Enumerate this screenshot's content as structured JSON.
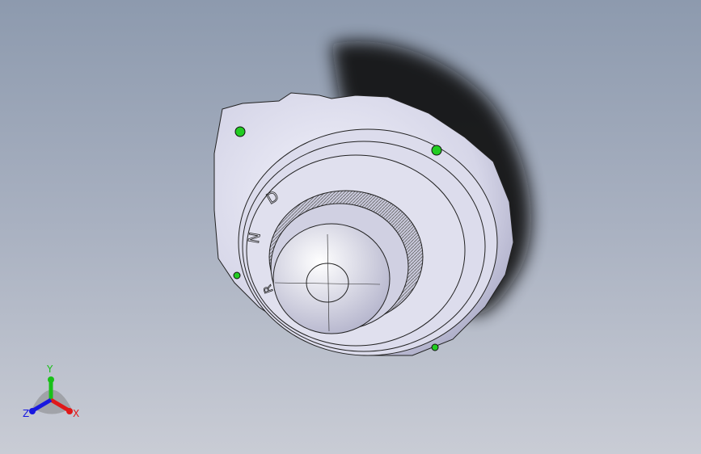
{
  "viewport": {
    "model_markings": [
      "D",
      "N",
      "R"
    ],
    "triad": {
      "x_label": "X",
      "y_label": "Y",
      "z_label": "Z",
      "colors": {
        "x": "#e01818",
        "y": "#18c018",
        "z": "#1818e0"
      }
    },
    "colors": {
      "background_top": "#8d9aae",
      "background_bottom": "#c9ccd5",
      "model": "#d8d8ea",
      "mate_markers": "#22cc22"
    }
  }
}
